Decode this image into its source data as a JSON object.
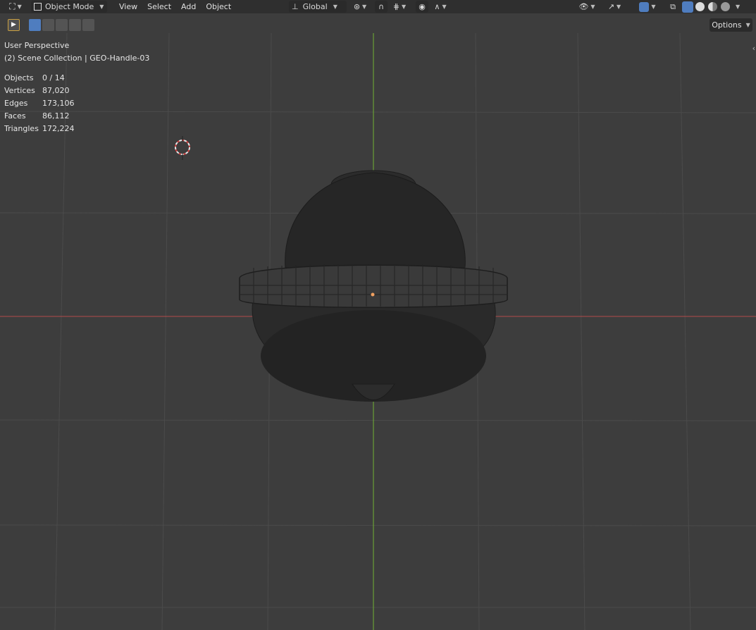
{
  "header": {
    "mode_label": "Object Mode",
    "menus": [
      {
        "name": "view",
        "label": "View"
      },
      {
        "name": "select",
        "label": "Select"
      },
      {
        "name": "add",
        "label": "Add"
      },
      {
        "name": "object",
        "label": "Object"
      }
    ],
    "transform_orientation": "Global"
  },
  "toolbar": {
    "options_label": "Options"
  },
  "viewport": {
    "perspective": "User Perspective",
    "collection": "(2) Scene Collection | GEO-Handle-03"
  },
  "stats": [
    {
      "label": "Objects",
      "value": "0 / 14"
    },
    {
      "label": "Vertices",
      "value": "87,020"
    },
    {
      "label": "Edges",
      "value": "173,106"
    },
    {
      "label": "Faces",
      "value": "86,112"
    },
    {
      "label": "Triangles",
      "value": "172,224"
    }
  ],
  "colors": {
    "x_axis": "#b34b4b",
    "y_axis": "#71b332",
    "grid": "#4a4a4a",
    "header_bg": "#2f2f2f",
    "active_blue": "#4f7dbf"
  },
  "icons": {
    "editor_type": "object-editor-icon",
    "cursor_3d": "3d-cursor-icon"
  }
}
